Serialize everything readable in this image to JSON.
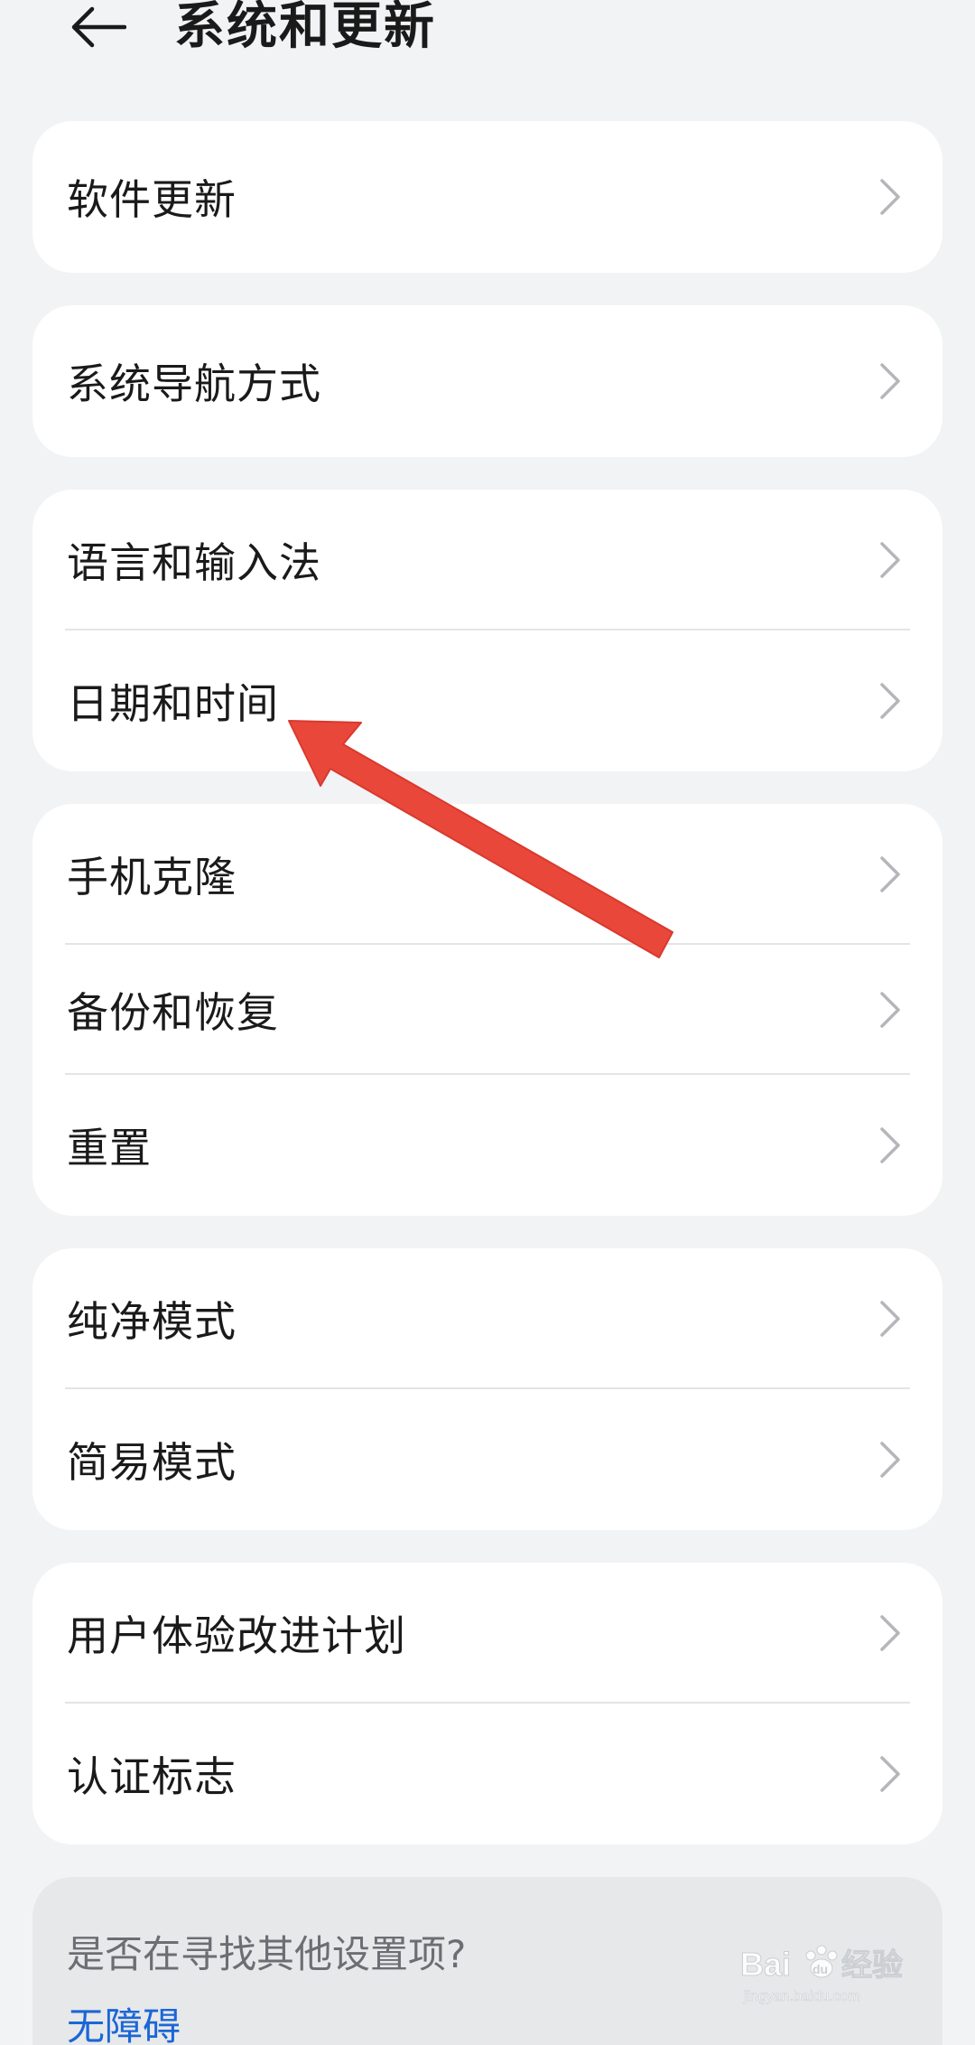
{
  "header": {
    "title": "系统和更新"
  },
  "cards": [
    {
      "items": [
        "软件更新"
      ]
    },
    {
      "items": [
        "系统导航方式"
      ]
    },
    {
      "items": [
        "语言和输入法",
        "日期和时间"
      ]
    },
    {
      "items": [
        "手机克隆",
        "备份和恢复",
        "重置"
      ]
    },
    {
      "items": [
        "纯净模式",
        "简易模式"
      ]
    },
    {
      "items": [
        "用户体验改进计划",
        "认证标志"
      ]
    }
  ],
  "suggestion": {
    "question": "是否在寻找其他设置项?",
    "link": "无障碍"
  },
  "watermark": {
    "brand": "Bai",
    "paw": "du",
    "cn": "经验",
    "site": "jingyan.baidu.com"
  },
  "colors": {
    "background": "#f1f3f5",
    "card": "#ffffff",
    "accent_link": "#1b66d6",
    "annotation_arrow": "#e8473a"
  },
  "icons": {
    "back": "arrow-left-icon",
    "row_chevron": "chevron-right-icon"
  }
}
